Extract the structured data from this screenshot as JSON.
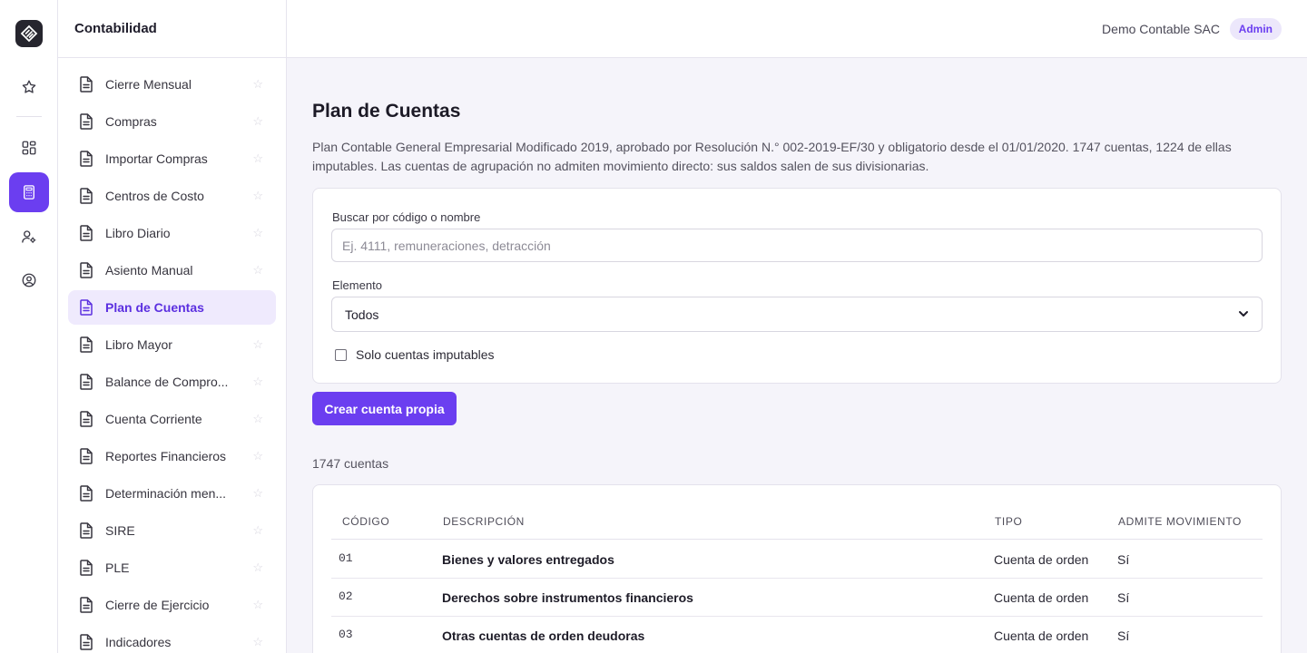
{
  "sidebar": {
    "title": "Contabilidad",
    "items": [
      {
        "label": "Cierre Mensual"
      },
      {
        "label": "Compras"
      },
      {
        "label": "Importar Compras"
      },
      {
        "label": "Centros de Costo"
      },
      {
        "label": "Libro Diario"
      },
      {
        "label": "Asiento Manual"
      },
      {
        "label": "Plan de Cuentas"
      },
      {
        "label": "Libro Mayor"
      },
      {
        "label": "Balance de Compro..."
      },
      {
        "label": "Cuenta Corriente"
      },
      {
        "label": "Reportes Financieros"
      },
      {
        "label": "Determinación men..."
      },
      {
        "label": "SIRE"
      },
      {
        "label": "PLE"
      },
      {
        "label": "Cierre de Ejercicio"
      },
      {
        "label": "Indicadores"
      }
    ]
  },
  "topbar": {
    "company": "Demo Contable SAC",
    "role": "Admin"
  },
  "page": {
    "title": "Plan de Cuentas",
    "description": "Plan Contable General Empresarial Modificado 2019, aprobado por Resolución N.° 002-2019-EF/30 y obligatorio desde el 01/01/2020. 1747 cuentas, 1224 de ellas imputables. Las cuentas de agrupación no admiten movimiento directo: sus saldos salen de sus divisionarias."
  },
  "filters": {
    "search_label": "Buscar por código o nombre",
    "search_placeholder": "Ej. 4111, remuneraciones, detracción",
    "search_value": "",
    "element_label": "Elemento",
    "element_value": "Todos",
    "only_imputable_label": "Solo cuentas imputables"
  },
  "actions": {
    "create_label": "Crear cuenta propia"
  },
  "results": {
    "count_text": "1747 cuentas"
  },
  "table": {
    "headers": [
      "CÓDIGO",
      "DESCRIPCIÓN",
      "TIPO",
      "ADMITE MOVIMIENTO"
    ],
    "rows": [
      {
        "code": "01",
        "description": "Bienes y valores entregados",
        "tipo": "Cuenta de orden",
        "movimiento": "Sí"
      },
      {
        "code": "02",
        "description": "Derechos sobre instrumentos financieros",
        "tipo": "Cuenta de orden",
        "movimiento": "Sí"
      },
      {
        "code": "03",
        "description": "Otras cuentas de orden deudoras",
        "tipo": "Cuenta de orden",
        "movimiento": "Sí"
      }
    ]
  },
  "colors": {
    "accent": "#6b3ef0",
    "active_bg": "#efeafd",
    "logo_bg": "#26252e"
  },
  "icons": {
    "rail": [
      "app-logo-icon",
      "star-icon",
      "dashboard-icon",
      "calculator-icon",
      "user-settings-icon",
      "user-circle-icon"
    ],
    "sidebar_item": "document-icon",
    "favorite": "star-outline-icon",
    "select": "chevron-down-icon"
  }
}
